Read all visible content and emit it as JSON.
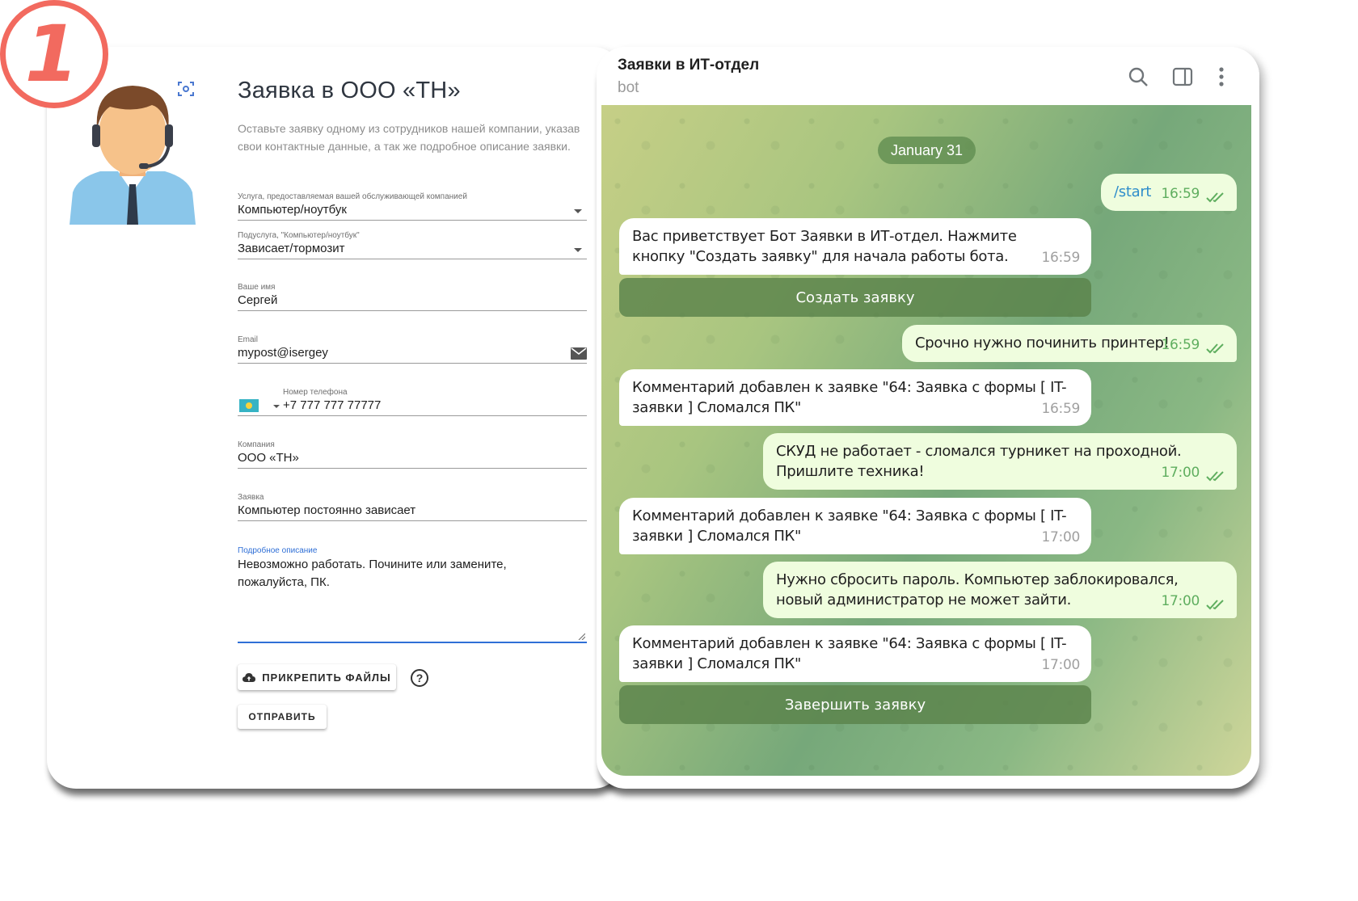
{
  "step_number": "1",
  "form": {
    "title": "Заявка в ООО «ТН»",
    "description": "Оставьте заявку одному из сотрудников нашей компании, указав свои контактные данные, а так же подробное описание заявки.",
    "fields": {
      "service": {
        "label": "Услуга, предоставляемая вашей обслуживающей компанией",
        "value": "Компьютер/ноутбук"
      },
      "subservice": {
        "label": "Подуслуга, \"Компьютер/ноутбук\"",
        "value": "Зависает/тормозит"
      },
      "name": {
        "label": "Ваше имя",
        "value": "Сергей"
      },
      "email": {
        "label": "Email",
        "value": "mypost@isergey"
      },
      "phone": {
        "label": "Номер телефона",
        "value": "+7 777 777 77777"
      },
      "company": {
        "label": "Компания",
        "value": "ООО «ТН»"
      },
      "request": {
        "label": "Заявка",
        "value": "Компьютер постоянно зависает"
      },
      "details": {
        "label": "Подробное описание",
        "value": "Невозможно работать. Почините или замените, пожалуйста, ПК."
      }
    },
    "attach_label": "ПРИКРЕПИТЬ ФАЙЛЫ",
    "help_label": "?",
    "submit_label": "ОТПРАВИТЬ"
  },
  "telegram": {
    "chat_title": "Заявки в ИТ-отдел",
    "chat_subtitle": "bot",
    "date": "January 31",
    "messages": [
      {
        "dir": "out",
        "text": "/start",
        "time": "16:59"
      },
      {
        "dir": "in",
        "text": "Вас приветствует Бот Заявки в ИТ-отдел. Нажмите кнопку \"Создать заявку\" для начала работы бота.",
        "time": "16:59"
      },
      {
        "dir": "out",
        "text": "Срочно нужно починить принтер!",
        "time": "16:59"
      },
      {
        "dir": "in",
        "text": "Комментарий добавлен к заявке \"64: Заявка с формы [ IT-заявки ] Сломался ПК\"",
        "time": "16:59"
      },
      {
        "dir": "out",
        "text": "СКУД не работает - сломался турникет на проходной. Пришлите техника!",
        "time": "17:00"
      },
      {
        "dir": "in",
        "text": "Комментарий добавлен к заявке \"64: Заявка с формы [ IT-заявки ] Сломался ПК\"",
        "time": "17:00"
      },
      {
        "dir": "out",
        "text": "Нужно сбросить пароль. Компьютер заблокировался, новый администратор не может зайти.",
        "time": "17:00"
      },
      {
        "dir": "in",
        "text": "Комментарий добавлен к заявке \"64: Заявка с формы [ IT-заявки ] Сломался ПК\"",
        "time": "17:00"
      }
    ],
    "buttons": {
      "create": "Создать заявку",
      "finish": "Завершить заявку"
    }
  },
  "colors": {
    "badge": "#f26a5f",
    "accent_blue": "#2f6fd6",
    "outgoing_bubble": "#effdde",
    "read_check": "#5fae5f"
  }
}
